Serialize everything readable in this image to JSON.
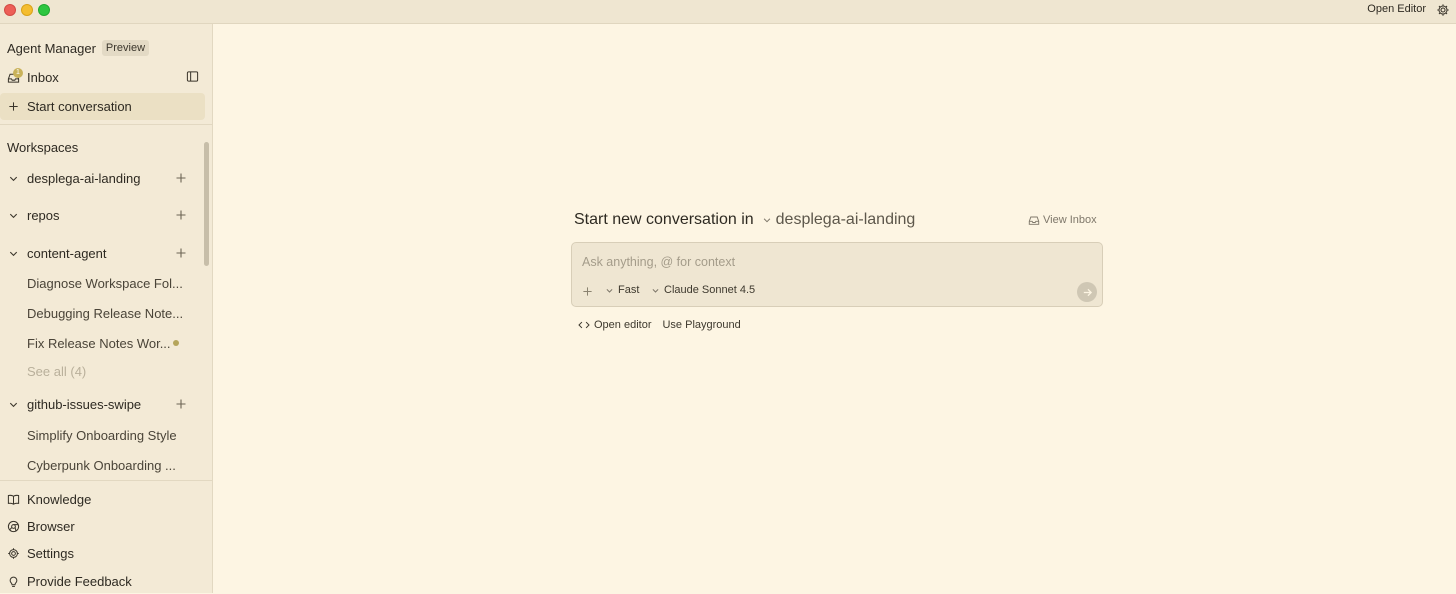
{
  "titlebar": {
    "open_editor": "Open Editor",
    "settings_icon": "gear-icon"
  },
  "sidebar": {
    "title": "Agent Manager",
    "badge": "Preview",
    "inbox": {
      "label": "Inbox",
      "count": "1",
      "icon": "inbox-icon"
    },
    "start_conversation": "Start conversation",
    "workspaces_heading": "Workspaces",
    "workspaces": [
      {
        "name": "desplega-ai-landing",
        "expanded": false
      },
      {
        "name": "repos",
        "expanded": false
      },
      {
        "name": "content-agent",
        "expanded": true,
        "conversations": [
          "Diagnose Workspace Fol...",
          "Debugging Release Note...",
          "Fix Release Notes Wor..."
        ],
        "see_all": "See all (4)"
      },
      {
        "name": "github-issues-swipe",
        "expanded": true,
        "conversations": [
          "Simplify Onboarding Style",
          "Cyberpunk Onboarding ..."
        ]
      }
    ],
    "bottom": [
      {
        "label": "Knowledge",
        "icon": "book-icon"
      },
      {
        "label": "Browser",
        "icon": "globe-icon"
      },
      {
        "label": "Settings",
        "icon": "gear-icon"
      },
      {
        "label": "Provide Feedback",
        "icon": "lightbulb-icon"
      }
    ]
  },
  "main": {
    "heading": "Start new conversation in",
    "workspace": "desplega-ai-landing",
    "view_inbox": "View Inbox",
    "composer": {
      "placeholder": "Ask anything, @ for context",
      "value": "",
      "mode": "Fast",
      "model": "Claude Sonnet 4.5"
    },
    "links": {
      "open_editor": "Open editor",
      "playground": "Use Playground"
    }
  },
  "colors": {
    "background": "#fdf5e3",
    "sidebar": "#f3ead6",
    "selected": "#ebe0c4",
    "accent_dot": "#b5a55b"
  }
}
